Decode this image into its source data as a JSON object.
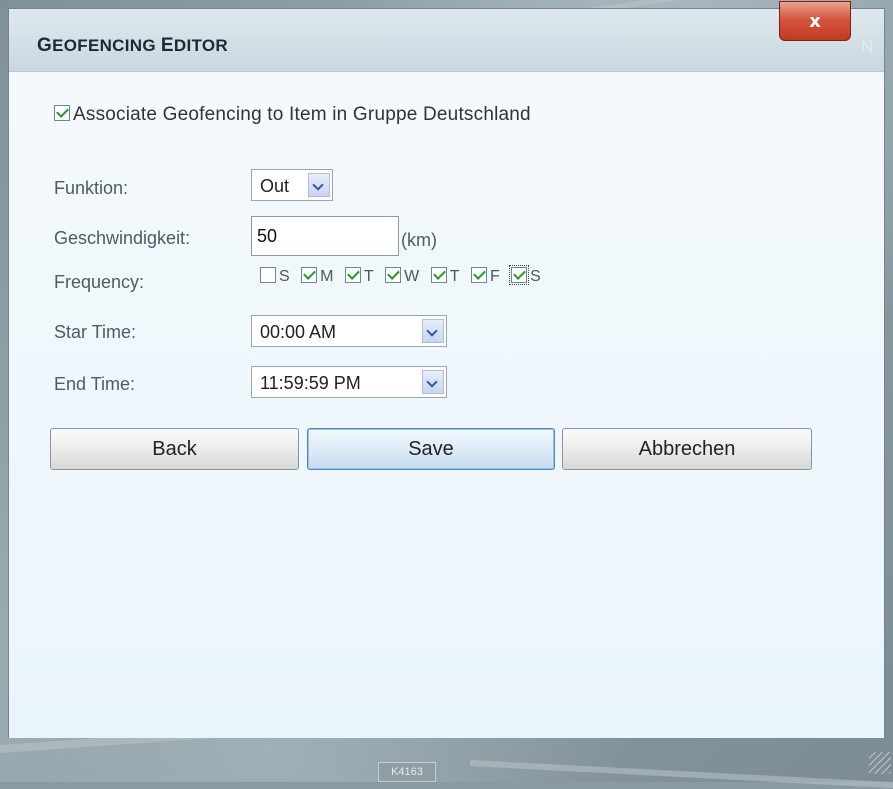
{
  "window": {
    "title_first": "G",
    "title_rest": "EOFENCING ",
    "title_second": "E",
    "title_second_rest": "DITOR",
    "close_label": "x",
    "ghost_text": "N"
  },
  "associate": {
    "checked": true,
    "label": "Associate Geofencing to Item in Gruppe Deutschland"
  },
  "form": {
    "funktion_label": "Funktion:",
    "funktion_value": "Out",
    "geschwindigkeit_label": "Geschwindigkeit:",
    "geschwindigkeit_value": "50",
    "geschwindigkeit_unit": "(km)",
    "frequency_label": "Frequency:",
    "days": [
      {
        "label": "S",
        "checked": false
      },
      {
        "label": "M",
        "checked": true
      },
      {
        "label": "T",
        "checked": true
      },
      {
        "label": "W",
        "checked": true
      },
      {
        "label": "T",
        "checked": true
      },
      {
        "label": "F",
        "checked": true
      },
      {
        "label": "S",
        "checked": true
      }
    ],
    "start_time_label": "Star Time:",
    "start_time_value": "00:00 AM",
    "end_time_label": "End Time:",
    "end_time_value": "11:59:59 PM"
  },
  "buttons": {
    "back": "Back",
    "save": "Save",
    "cancel": "Abbrechen"
  },
  "map": {
    "road_sign": "K4163"
  }
}
